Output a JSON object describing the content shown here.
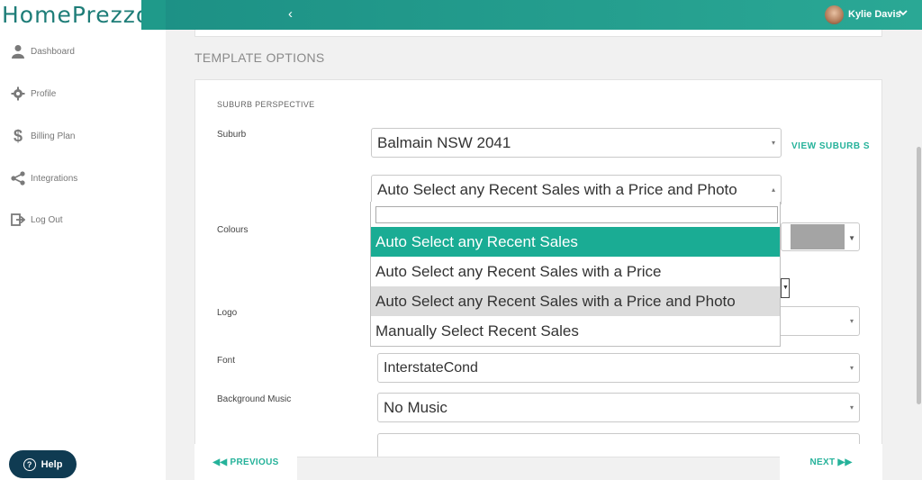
{
  "brand": {
    "name": "HomePrezzo",
    "collapse_icon": "‹"
  },
  "user": {
    "name": "Kylie Davis",
    "caret": "⌄"
  },
  "sidebar": {
    "items": [
      {
        "label": "Dashboard",
        "icon": "user-icon"
      },
      {
        "label": "Profile",
        "icon": "gear-icon"
      },
      {
        "label": "Billing Plan",
        "icon": "dollar-icon"
      },
      {
        "label": "Integrations",
        "icon": "share-icon"
      },
      {
        "label": "Log Out",
        "icon": "logout-icon"
      }
    ]
  },
  "help": {
    "label": "Help"
  },
  "main": {
    "section_title": "TEMPLATE OPTIONS",
    "subsection_title": "SUBURB PERSPECTIVE",
    "labels": {
      "suburb": "Suburb",
      "colours": "Colours",
      "logo": "Logo",
      "font": "Font",
      "background_music": "Background Music"
    },
    "suburb_value": "Balmain NSW 2041",
    "view_suburb_link": "VIEW SUBURB S",
    "sales_select_value": "Auto Select any Recent Sales with a Price and Photo",
    "font_value": "InterstateCond",
    "music_value": "No Music",
    "colour_swatch": "#a4a4a4"
  },
  "dropdown": {
    "search_value": "",
    "options": [
      "Auto Select any Recent Sales",
      "Auto Select any Recent Sales with a Price",
      "Auto Select any Recent Sales with a Price and Photo",
      "Manually Select Recent Sales"
    ],
    "highlighted": "Auto Select any Recent Sales",
    "selected": "Auto Select any Recent Sales with a Price and Photo"
  },
  "nav": {
    "previous": "◀◀ PREVIOUS",
    "next": "NEXT ▶▶"
  },
  "colors": {
    "accent": "#1aac94",
    "topbar": "#1f9a8a",
    "help_bg": "#0f3b52"
  }
}
